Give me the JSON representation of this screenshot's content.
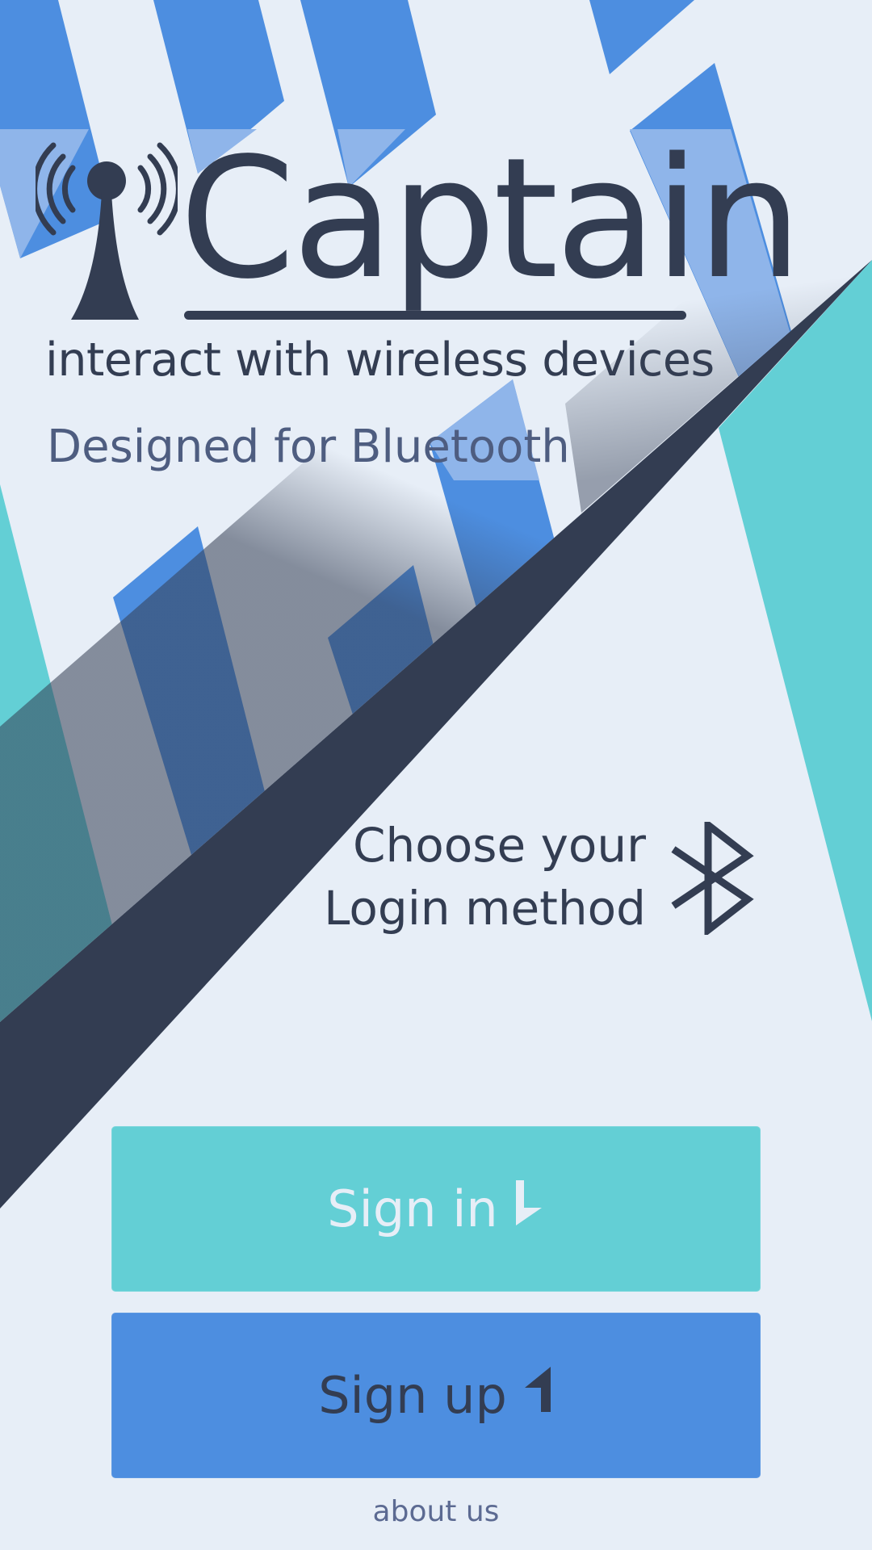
{
  "app": {
    "title": "Captain",
    "tagline": "interact with wireless devices",
    "subtitle": "Designed for Bluetooth"
  },
  "login": {
    "prompt_line1": "Choose your",
    "prompt_line2": "Login method"
  },
  "buttons": {
    "signin_label": "Sign in",
    "signup_label": "Sign up"
  },
  "footer": {
    "about_label": "about us"
  },
  "icons": {
    "logo": "antenna-icon",
    "bluetooth": "bluetooth-icon",
    "signin": "sign-in-arrow-icon",
    "signup": "sign-up-arrow-icon"
  },
  "colors": {
    "background": "#e7eef7",
    "dark": "#333d52",
    "teal": "#63cfd5",
    "blue": "#4d8ee0",
    "light_blue": "#8fb5ea",
    "link": "#5c6a92"
  }
}
